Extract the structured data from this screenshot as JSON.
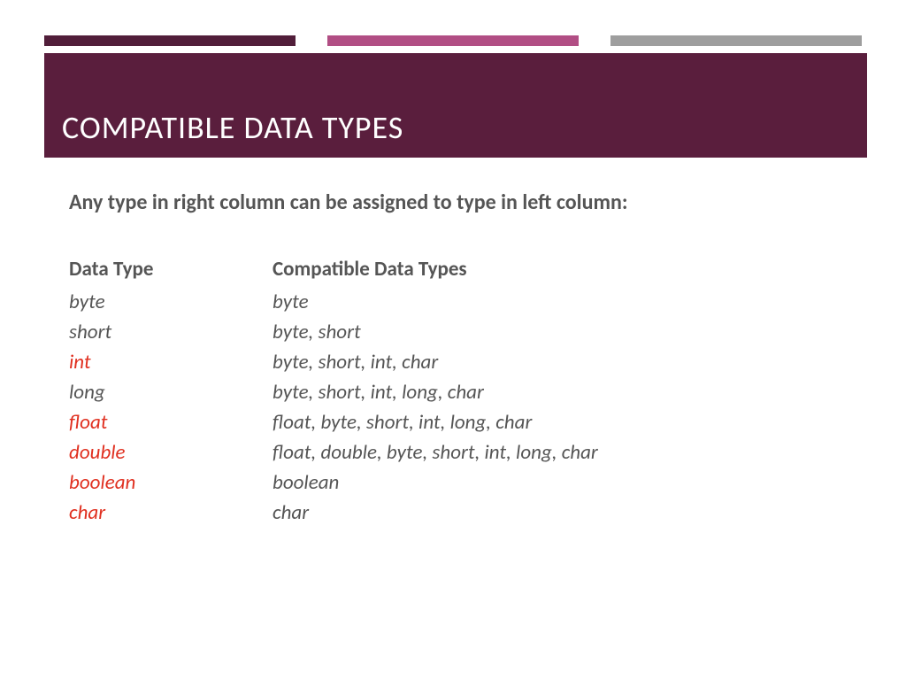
{
  "title": "COMPATIBLE DATA TYPES",
  "intro": "Any type in right column can be assigned to type in left column:",
  "header": {
    "left": "Data Type",
    "right": "Compatible Data Types"
  },
  "rows": [
    {
      "left": "byte",
      "right": "byte",
      "highlight": false
    },
    {
      "left": "short",
      "right": "byte, short",
      "highlight": false
    },
    {
      "left": "int",
      "right": " byte, short, int, char",
      "highlight": true
    },
    {
      "left": "long",
      "right": "byte, short, int, long, char",
      "highlight": false
    },
    {
      "left": "float",
      "right": " float, byte, short, int, long, char",
      "highlight": true
    },
    {
      "left": "double",
      "right": "float, double, byte, short, int, long, char",
      "highlight": true
    },
    {
      "left": "boolean",
      "right": "boolean",
      "highlight": true
    },
    {
      "left": "char",
      "right": " char",
      "highlight": true
    }
  ]
}
